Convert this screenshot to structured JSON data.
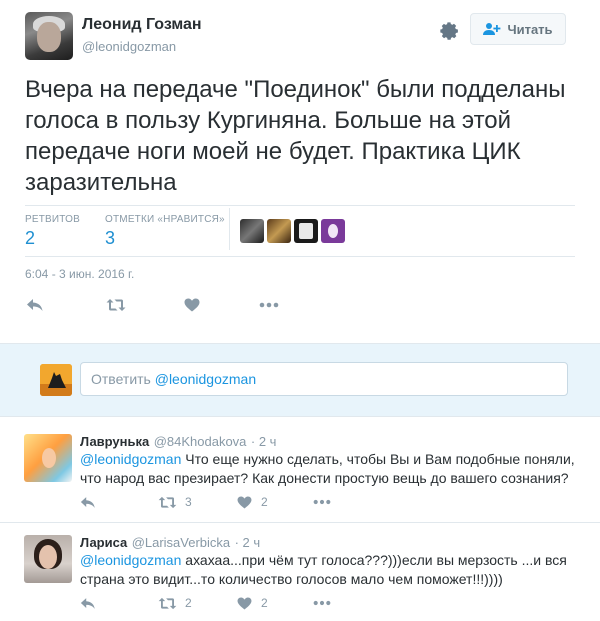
{
  "author": {
    "name": "Леонид Гозман",
    "handle": "@leonidgozman"
  },
  "follow_button": {
    "label": "Читать",
    "icon": "add-user-icon"
  },
  "tweet": {
    "text": "Вчера на передаче \"Поединок\" были подделаны голоса в пользу Кургиняна. Больше на этой передаче ноги моей не будет. Практика ЦИК заразительна",
    "timestamp": "6:04 - 3 июн. 2016 г."
  },
  "stats": {
    "retweets_label": "РЕТВИТОВ",
    "retweets_value": "2",
    "likes_label": "ОТМЕТКИ «НРАВИТСЯ»",
    "likes_value": "3"
  },
  "reply_box": {
    "placeholder_prefix": "Ответить",
    "mention": "@leonidgozman"
  },
  "replies": [
    {
      "name": "Лаврунька",
      "handle": "@84Khodakova",
      "time": "· 2 ч",
      "mention": "@leonidgozman",
      "text": "Что еще нужно сделать, чтобы Вы и Вам подобные поняли, что народ вас презирает? Как донести простую вещь до вашего сознания?",
      "retweets": "3",
      "likes": "2"
    },
    {
      "name": "Лариса",
      "handle": "@LarisaVerbicka",
      "time": "· 2 ч",
      "mention": "@leonidgozman",
      "text": "ахахаа...при чём тут голоса???)))если вы мерзость ...и вся страна это видит...то количество голосов мало чем поможет!!!))))",
      "retweets": "2",
      "likes": "2"
    }
  ],
  "colors": {
    "link": "#1b95e0",
    "muted": "#8899a6",
    "text": "#292f33",
    "reply_bg": "#e8f4fb"
  }
}
